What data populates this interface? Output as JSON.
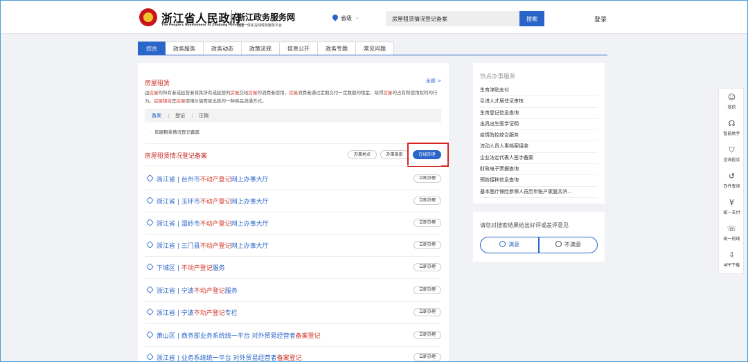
{
  "header": {
    "gov_name": "浙江省人民政府",
    "gov_name_en": "The People's Government of Zhejiang Province",
    "service_name": "浙江政务服务网",
    "service_sub": "全国一体化在线政务服务平台",
    "location": "省级",
    "search_value": "房屋租赁情况登记备案",
    "search_button": "搜索",
    "login": "登录"
  },
  "tabs": [
    "综合",
    "政务服务",
    "政务动态",
    "政策法规",
    "信息公开",
    "政务专题",
    "常见问题"
  ],
  "topic": {
    "title": "房屋租赁",
    "all_link": "全部 >",
    "desc_parts": [
      "由",
      "房屋",
      "的所有者或经营者将其所有或经营的",
      "房屋",
      "交给",
      "房屋",
      "的消费者使用，",
      "房屋",
      "消费者通过定期交付一定数额的租金，取得",
      "房屋",
      "的占有和使用权利的行为。",
      "房屋租赁",
      "是",
      "房屋",
      "使用价值零星出售的一种商品流通方式。"
    ],
    "subtabs": [
      "备案",
      "登记",
      "注销"
    ],
    "sub_item": "房屋租赁情况登记备案"
  },
  "record": {
    "title": "房屋租赁情况登记备案",
    "btn_location": "办事地点",
    "btn_guide": "办事指南",
    "btn_online": "在线办理"
  },
  "results": [
    {
      "parts": [
        "浙江省 | 台州市",
        "不动产登记",
        "网上办事大厅"
      ],
      "button": "立即办理"
    },
    {
      "parts": [
        "浙江省 | 玉环市",
        "不动产登记",
        "网上办事大厅"
      ],
      "button": "立即办理"
    },
    {
      "parts": [
        "浙江省 | 温岭市",
        "不动产登记",
        "网上办事大厅"
      ],
      "button": "立即办理"
    },
    {
      "parts": [
        "浙江省 | 三门县",
        "不动产登记",
        "网上办事大厅"
      ],
      "button": "立即办理"
    },
    {
      "parts": [
        "下城区 | ",
        "不动产登记",
        "服务"
      ],
      "button": "立即办理"
    },
    {
      "parts": [
        "浙江省 | 宁波",
        "不动产登记",
        "服务"
      ],
      "button": "立即办理"
    },
    {
      "parts": [
        "浙江省 | 宁波",
        "不动产登记",
        "专栏"
      ],
      "button": "立即办理"
    },
    {
      "parts": [
        "萧山区 | 商务部业务系统统一平台 对外贸易经营者",
        "备案登记",
        ""
      ],
      "button": "立即办理"
    },
    {
      "parts": [
        "浙江省 | 业务系统统一平台 对外贸易经营者",
        "备案登记",
        ""
      ],
      "button": "立即办理"
    }
  ],
  "hot": {
    "title": "热点办事服务",
    "items": [
      "生育津贴支付",
      "引进人才居住证审核",
      "生育登记信息查询",
      "出具出生医学证明",
      "疫情防控综合服务",
      "流动人员人事档案接收",
      "企业法定代表人签字备案",
      "财政电子票据查询",
      "预防接种信息查询",
      "基本医疗保险参保人员历年账户家庭共济..."
    ]
  },
  "feedback": {
    "question": "请您对搜索结果给出好评或差评意见",
    "good": "满意",
    "bad": "不满意"
  },
  "dock": [
    {
      "icon": "user-icon",
      "glyph": "☺",
      "label": "我的"
    },
    {
      "icon": "headset-icon",
      "glyph": "☊",
      "label": "智能助手"
    },
    {
      "icon": "shield-icon",
      "glyph": "⛉",
      "label": "咨询投诉"
    },
    {
      "icon": "history-icon",
      "glyph": "↺",
      "label": "办件查询"
    },
    {
      "icon": "yuan-icon",
      "glyph": "¥",
      "label": "统一支付"
    },
    {
      "icon": "phone-icon",
      "glyph": "☏",
      "label": "统一热线"
    },
    {
      "icon": "download-icon",
      "glyph": "⇩",
      "label": "APP下载"
    }
  ],
  "colors": {
    "primary": "#2a66c9",
    "keyword": "#d13a2e",
    "highlight_box": "#d9251d"
  }
}
